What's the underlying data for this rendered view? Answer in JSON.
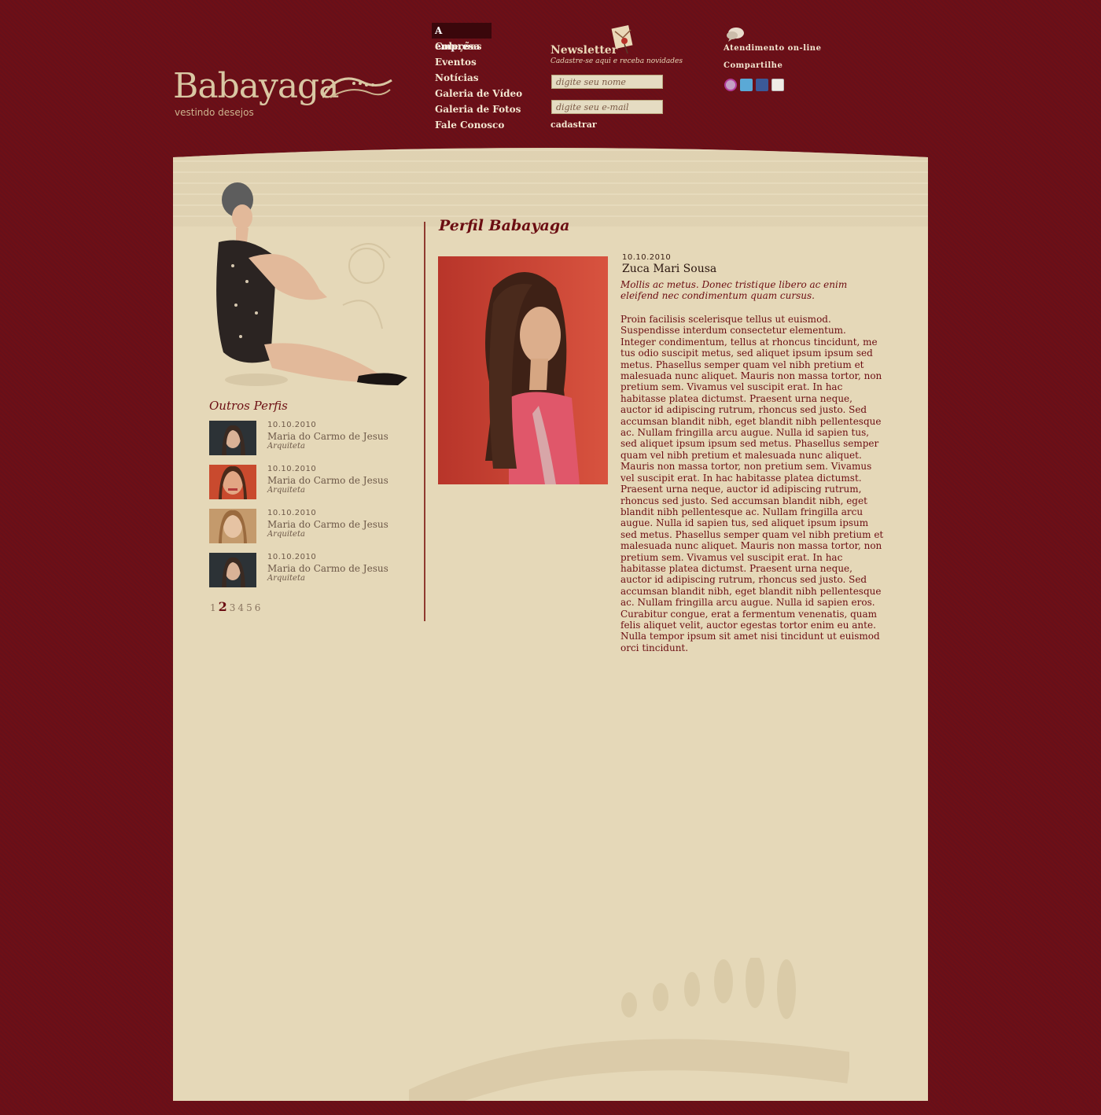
{
  "brand": {
    "name": "Babayaga",
    "tagline": "vestindo desejos"
  },
  "nav": {
    "items": [
      {
        "label": "A empresa",
        "active": true
      },
      {
        "label": "Coleções"
      },
      {
        "label": "Eventos"
      },
      {
        "label": "Notícias"
      },
      {
        "label": "Galeria de Vídeo"
      },
      {
        "label": "Galeria de Fotos"
      },
      {
        "label": "Fale Conosco"
      }
    ]
  },
  "newsletter": {
    "title": "Newsletter",
    "subtitle": "Cadastre-se aqui e receba novidades",
    "name_placeholder": "digite seu nome",
    "email_placeholder": "digite seu e-mail",
    "submit_label": "cadastrar"
  },
  "social": {
    "online_label": "Atendimento on-line",
    "share_label": "Compartilhe",
    "icons": [
      "orkut-icon",
      "twitter-icon",
      "facebook-icon",
      "email-icon"
    ]
  },
  "sidebar": {
    "title": "Outros Perfis",
    "profiles": [
      {
        "date": "10.10.2010",
        "name": "Maria do Carmo de Jesus",
        "profession": "Arquiteta"
      },
      {
        "date": "10.10.2010",
        "name": "Maria do Carmo de Jesus",
        "profession": "Arquiteta"
      },
      {
        "date": "10.10.2010",
        "name": "Maria do Carmo de Jesus",
        "profession": "Arquiteta"
      },
      {
        "date": "10.10.2010",
        "name": "Maria do Carmo de Jesus",
        "profession": "Arquiteta"
      }
    ],
    "pagination": [
      "1",
      "2",
      "3",
      "4",
      "5",
      "6"
    ],
    "current_page": "2"
  },
  "profile": {
    "title": "Perfil Babayaga",
    "date": "10.10.2010",
    "name": "Zuca Mari Sousa",
    "summary": "Mollis ac metus. Donec tristique libero ac enim eleifend nec condimentum quam cursus.",
    "body": "Proin facilisis scelerisque tellus ut euismod. Suspendisse interdum consectetur elementum. Integer condimentum, tellus at rhoncus tincidunt, me tus odio suscipit metus, sed aliquet ipsum ipsum sed metus. Phasellus semper quam vel nibh pretium et malesuada nunc aliquet. Mauris non massa tortor, non pretium sem. Vivamus vel suscipit erat. In hac habitasse platea dictumst. Praesent urna neque, auctor id adipiscing rutrum, rhoncus sed justo. Sed accumsan blandit nibh, eget blandit nibh pellentesque ac. Nullam fringilla arcu augue. Nulla id sapien tus, sed aliquet ipsum ipsum sed metus. Phasellus semper quam vel nibh pretium et malesuada nunc aliquet. Mauris non massa tortor, non pretium sem. Vivamus vel suscipit erat. In hac habitasse platea dictumst. Praesent urna neque, auctor id adipiscing rutrum, rhoncus sed justo. Sed accumsan blandit nibh, eget blandit nibh pellentesque ac. Nullam fringilla arcu augue. Nulla id sapien tus, sed aliquet ipsum ipsum sed metus. Phasellus semper quam vel nibh pretium et malesuada nunc aliquet. Mauris non massa tortor, non pretium sem. Vivamus vel suscipit erat. In hac habitasse platea dictumst. Praesent urna neque, auctor id adipiscing rutrum, rhoncus sed justo. Sed accumsan blandit nibh, eget blandit nibh pellentesque ac. Nullam fringilla arcu augue. Nulla id sapien eros. Curabitur congue, erat a fermentum venenatis, quam felis aliquet velit, auctor egestas tortor enim eu ante. Nulla tempor ipsum sit amet nisi tincidunt ut euismod orci tincidunt."
  },
  "colors": {
    "background": "#6e0f16",
    "panel": "#e5d8b8",
    "accent": "#6b0d12",
    "nav_text": "#f3e6d0"
  }
}
